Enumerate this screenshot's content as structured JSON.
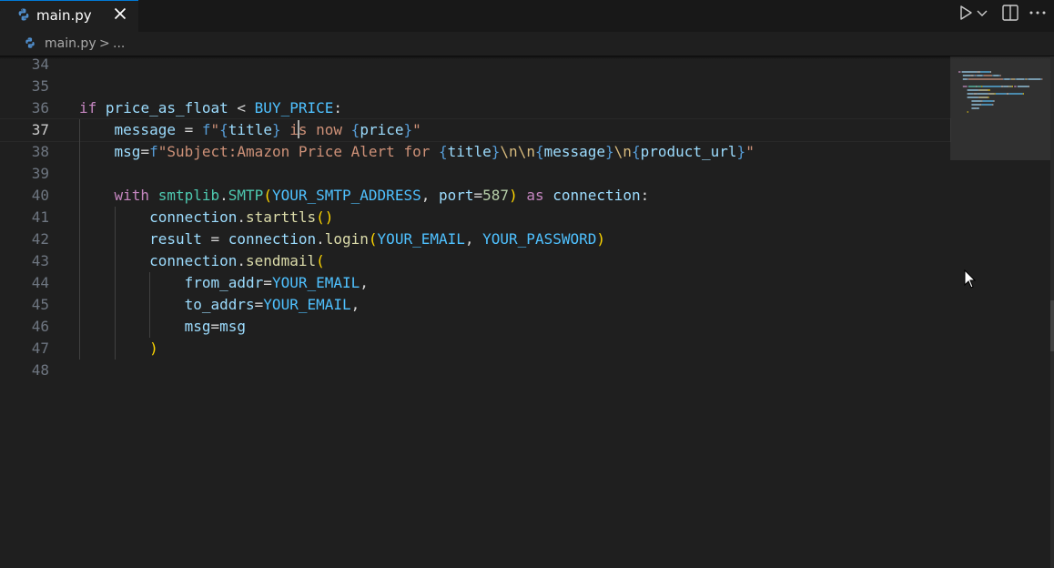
{
  "tab": {
    "label": "main.py",
    "icon": "python-icon",
    "close_icon": "close-icon"
  },
  "actions": [
    {
      "name": "run-python-file-button",
      "icon": "play-icon"
    },
    {
      "name": "run-options-dropdown",
      "icon": "chevron-down-icon"
    },
    {
      "name": "split-editor-button",
      "icon": "split-editor-icon"
    },
    {
      "name": "more-actions-button",
      "icon": "ellipsis-icon"
    }
  ],
  "breadcrumb": {
    "file": "main.py",
    "separator": ">",
    "more": "..."
  },
  "editor": {
    "active_line": "37",
    "lines": [
      {
        "n": "34",
        "tokens": []
      },
      {
        "n": "35",
        "tokens": []
      },
      {
        "n": "36",
        "tokens": [
          {
            "t": "if",
            "c": "kw"
          },
          {
            "t": " ",
            "c": ""
          },
          {
            "t": "price_as_float",
            "c": "var"
          },
          {
            "t": " < ",
            "c": "op"
          },
          {
            "t": "BUY_PRICE",
            "c": "const"
          },
          {
            "t": ":",
            "c": "op"
          }
        ]
      },
      {
        "n": "37",
        "tokens": [
          {
            "t": "    ",
            "c": ""
          },
          {
            "t": "message",
            "c": "var"
          },
          {
            "t": " = ",
            "c": "op"
          },
          {
            "t": "f",
            "c": "kw2"
          },
          {
            "t": "\"",
            "c": "str"
          },
          {
            "t": "{",
            "c": "kw2"
          },
          {
            "t": "title",
            "c": "var"
          },
          {
            "t": "}",
            "c": "kw2"
          },
          {
            "t": " i",
            "c": "str"
          },
          {
            "t": "CURSOR",
            "c": "cursor"
          },
          {
            "t": "s now ",
            "c": "str"
          },
          {
            "t": "{",
            "c": "kw2"
          },
          {
            "t": "price",
            "c": "var"
          },
          {
            "t": "}",
            "c": "kw2"
          },
          {
            "t": "\"",
            "c": "str"
          }
        ]
      },
      {
        "n": "38",
        "tokens": [
          {
            "t": "    ",
            "c": ""
          },
          {
            "t": "msg",
            "c": "var"
          },
          {
            "t": "=",
            "c": "op"
          },
          {
            "t": "f",
            "c": "kw2"
          },
          {
            "t": "\"Subject:Amazon Price Alert for ",
            "c": "str"
          },
          {
            "t": "{",
            "c": "kw2"
          },
          {
            "t": "title",
            "c": "var"
          },
          {
            "t": "}",
            "c": "kw2"
          },
          {
            "t": "\\n\\n",
            "c": "esc"
          },
          {
            "t": "{",
            "c": "kw2"
          },
          {
            "t": "message",
            "c": "var"
          },
          {
            "t": "}",
            "c": "kw2"
          },
          {
            "t": "\\n",
            "c": "esc"
          },
          {
            "t": "{",
            "c": "kw2"
          },
          {
            "t": "product_url",
            "c": "var"
          },
          {
            "t": "}",
            "c": "kw2"
          },
          {
            "t": "\"",
            "c": "str"
          }
        ]
      },
      {
        "n": "39",
        "tokens": []
      },
      {
        "n": "40",
        "tokens": [
          {
            "t": "    ",
            "c": ""
          },
          {
            "t": "with",
            "c": "kw"
          },
          {
            "t": " ",
            "c": ""
          },
          {
            "t": "smtplib",
            "c": "cls"
          },
          {
            "t": ".",
            "c": "op"
          },
          {
            "t": "SMTP",
            "c": "cls"
          },
          {
            "t": "(",
            "c": "b1"
          },
          {
            "t": "YOUR_SMTP_ADDRESS",
            "c": "const"
          },
          {
            "t": ", ",
            "c": "op"
          },
          {
            "t": "port",
            "c": "var"
          },
          {
            "t": "=",
            "c": "op"
          },
          {
            "t": "587",
            "c": "num"
          },
          {
            "t": ")",
            "c": "b1"
          },
          {
            "t": " ",
            "c": ""
          },
          {
            "t": "as",
            "c": "kw"
          },
          {
            "t": " ",
            "c": ""
          },
          {
            "t": "connection",
            "c": "var"
          },
          {
            "t": ":",
            "c": "op"
          }
        ]
      },
      {
        "n": "41",
        "tokens": [
          {
            "t": "        ",
            "c": ""
          },
          {
            "t": "connection",
            "c": "var"
          },
          {
            "t": ".",
            "c": "op"
          },
          {
            "t": "starttls",
            "c": "fn"
          },
          {
            "t": "()",
            "c": "b1"
          }
        ]
      },
      {
        "n": "42",
        "tokens": [
          {
            "t": "        ",
            "c": ""
          },
          {
            "t": "result",
            "c": "var"
          },
          {
            "t": " = ",
            "c": "op"
          },
          {
            "t": "connection",
            "c": "var"
          },
          {
            "t": ".",
            "c": "op"
          },
          {
            "t": "login",
            "c": "fn"
          },
          {
            "t": "(",
            "c": "b1"
          },
          {
            "t": "YOUR_EMAIL",
            "c": "const"
          },
          {
            "t": ", ",
            "c": "op"
          },
          {
            "t": "YOUR_PASSWORD",
            "c": "const"
          },
          {
            "t": ")",
            "c": "b1"
          }
        ]
      },
      {
        "n": "43",
        "tokens": [
          {
            "t": "        ",
            "c": ""
          },
          {
            "t": "connection",
            "c": "var"
          },
          {
            "t": ".",
            "c": "op"
          },
          {
            "t": "sendmail",
            "c": "fn"
          },
          {
            "t": "(",
            "c": "b1"
          }
        ]
      },
      {
        "n": "44",
        "tokens": [
          {
            "t": "            ",
            "c": ""
          },
          {
            "t": "from_addr",
            "c": "var"
          },
          {
            "t": "=",
            "c": "op"
          },
          {
            "t": "YOUR_EMAIL",
            "c": "const"
          },
          {
            "t": ",",
            "c": "op"
          }
        ]
      },
      {
        "n": "45",
        "tokens": [
          {
            "t": "            ",
            "c": ""
          },
          {
            "t": "to_addrs",
            "c": "var"
          },
          {
            "t": "=",
            "c": "op"
          },
          {
            "t": "YOUR_EMAIL",
            "c": "const"
          },
          {
            "t": ",",
            "c": "op"
          }
        ]
      },
      {
        "n": "46",
        "tokens": [
          {
            "t": "            ",
            "c": ""
          },
          {
            "t": "msg",
            "c": "var"
          },
          {
            "t": "=",
            "c": "op"
          },
          {
            "t": "msg",
            "c": "var"
          }
        ]
      },
      {
        "n": "47",
        "tokens": [
          {
            "t": "        ",
            "c": ""
          },
          {
            "t": ")",
            "c": "b1"
          }
        ]
      },
      {
        "n": "48",
        "tokens": []
      }
    ]
  },
  "colors": {
    "accent": "#0078d4",
    "editor_bg": "#1f1f1f",
    "keyword": "#c586c0",
    "variable": "#9cdcfe",
    "constant": "#4fc1ff",
    "string": "#ce9178"
  }
}
